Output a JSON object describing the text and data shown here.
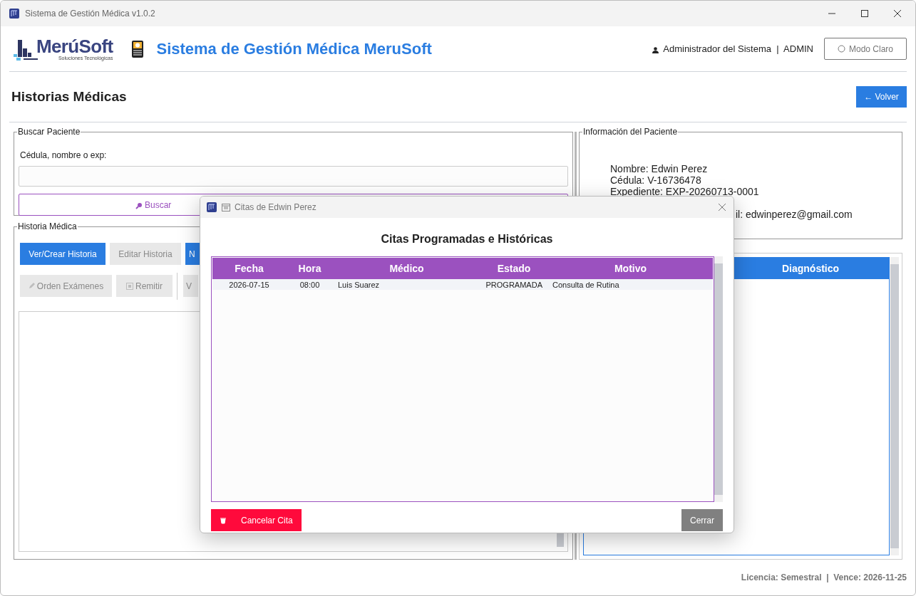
{
  "window": {
    "title": "Sistema de Gestión Médica v1.0.2"
  },
  "header": {
    "logo_text": "MerúSoft",
    "logo_tagline": "Soluciones Tecnológicas",
    "title": "Sistema de Gestión Médica MeruSoft",
    "user": "Administrador del Sistema  |  ADMIN",
    "theme_button": "Modo Claro"
  },
  "page": {
    "title": "Historias Médicas",
    "back_button": "← Volver"
  },
  "search": {
    "legend": "Buscar Paciente",
    "label": "Cédula, nombre o exp:",
    "button": "Buscar"
  },
  "history": {
    "legend": "Historia Médica",
    "buttons": [
      {
        "label": "Ver/Crear Historia",
        "disabled": false
      },
      {
        "label": "Editar Historia",
        "disabled": true
      },
      {
        "label": "N",
        "disabled": false
      }
    ],
    "actions": [
      {
        "label": "Orden Exámenes",
        "disabled": true
      },
      {
        "label": "Remitir",
        "disabled": true
      },
      {
        "label": "V",
        "disabled": true
      }
    ]
  },
  "patient_info": {
    "legend": "Información del Paciente",
    "lines": [
      "Nombre: Edwin Perez",
      "Cédula: V-16736478",
      "Expediente: EXP-20260713-0001"
    ],
    "email_fragment": "il: edwinperez@gmail.com"
  },
  "records_table": {
    "columns": [
      "Diagnóstico"
    ]
  },
  "dialog": {
    "title": "Citas de Edwin Perez",
    "heading": "Citas Programadas e Históricas",
    "table": {
      "columns": [
        "Fecha",
        "Hora",
        "Médico",
        "Estado",
        "Motivo"
      ],
      "rows": [
        [
          "2026-07-15",
          "08:00",
          "Luis Suarez",
          "PROGRAMADA",
          "Consulta de Rutina"
        ]
      ]
    },
    "cancel_button": "Cancelar Cita",
    "close_button": "Cerrar"
  },
  "footer": "Licencia: Semestral  |  Vence: 2026-11-25"
}
